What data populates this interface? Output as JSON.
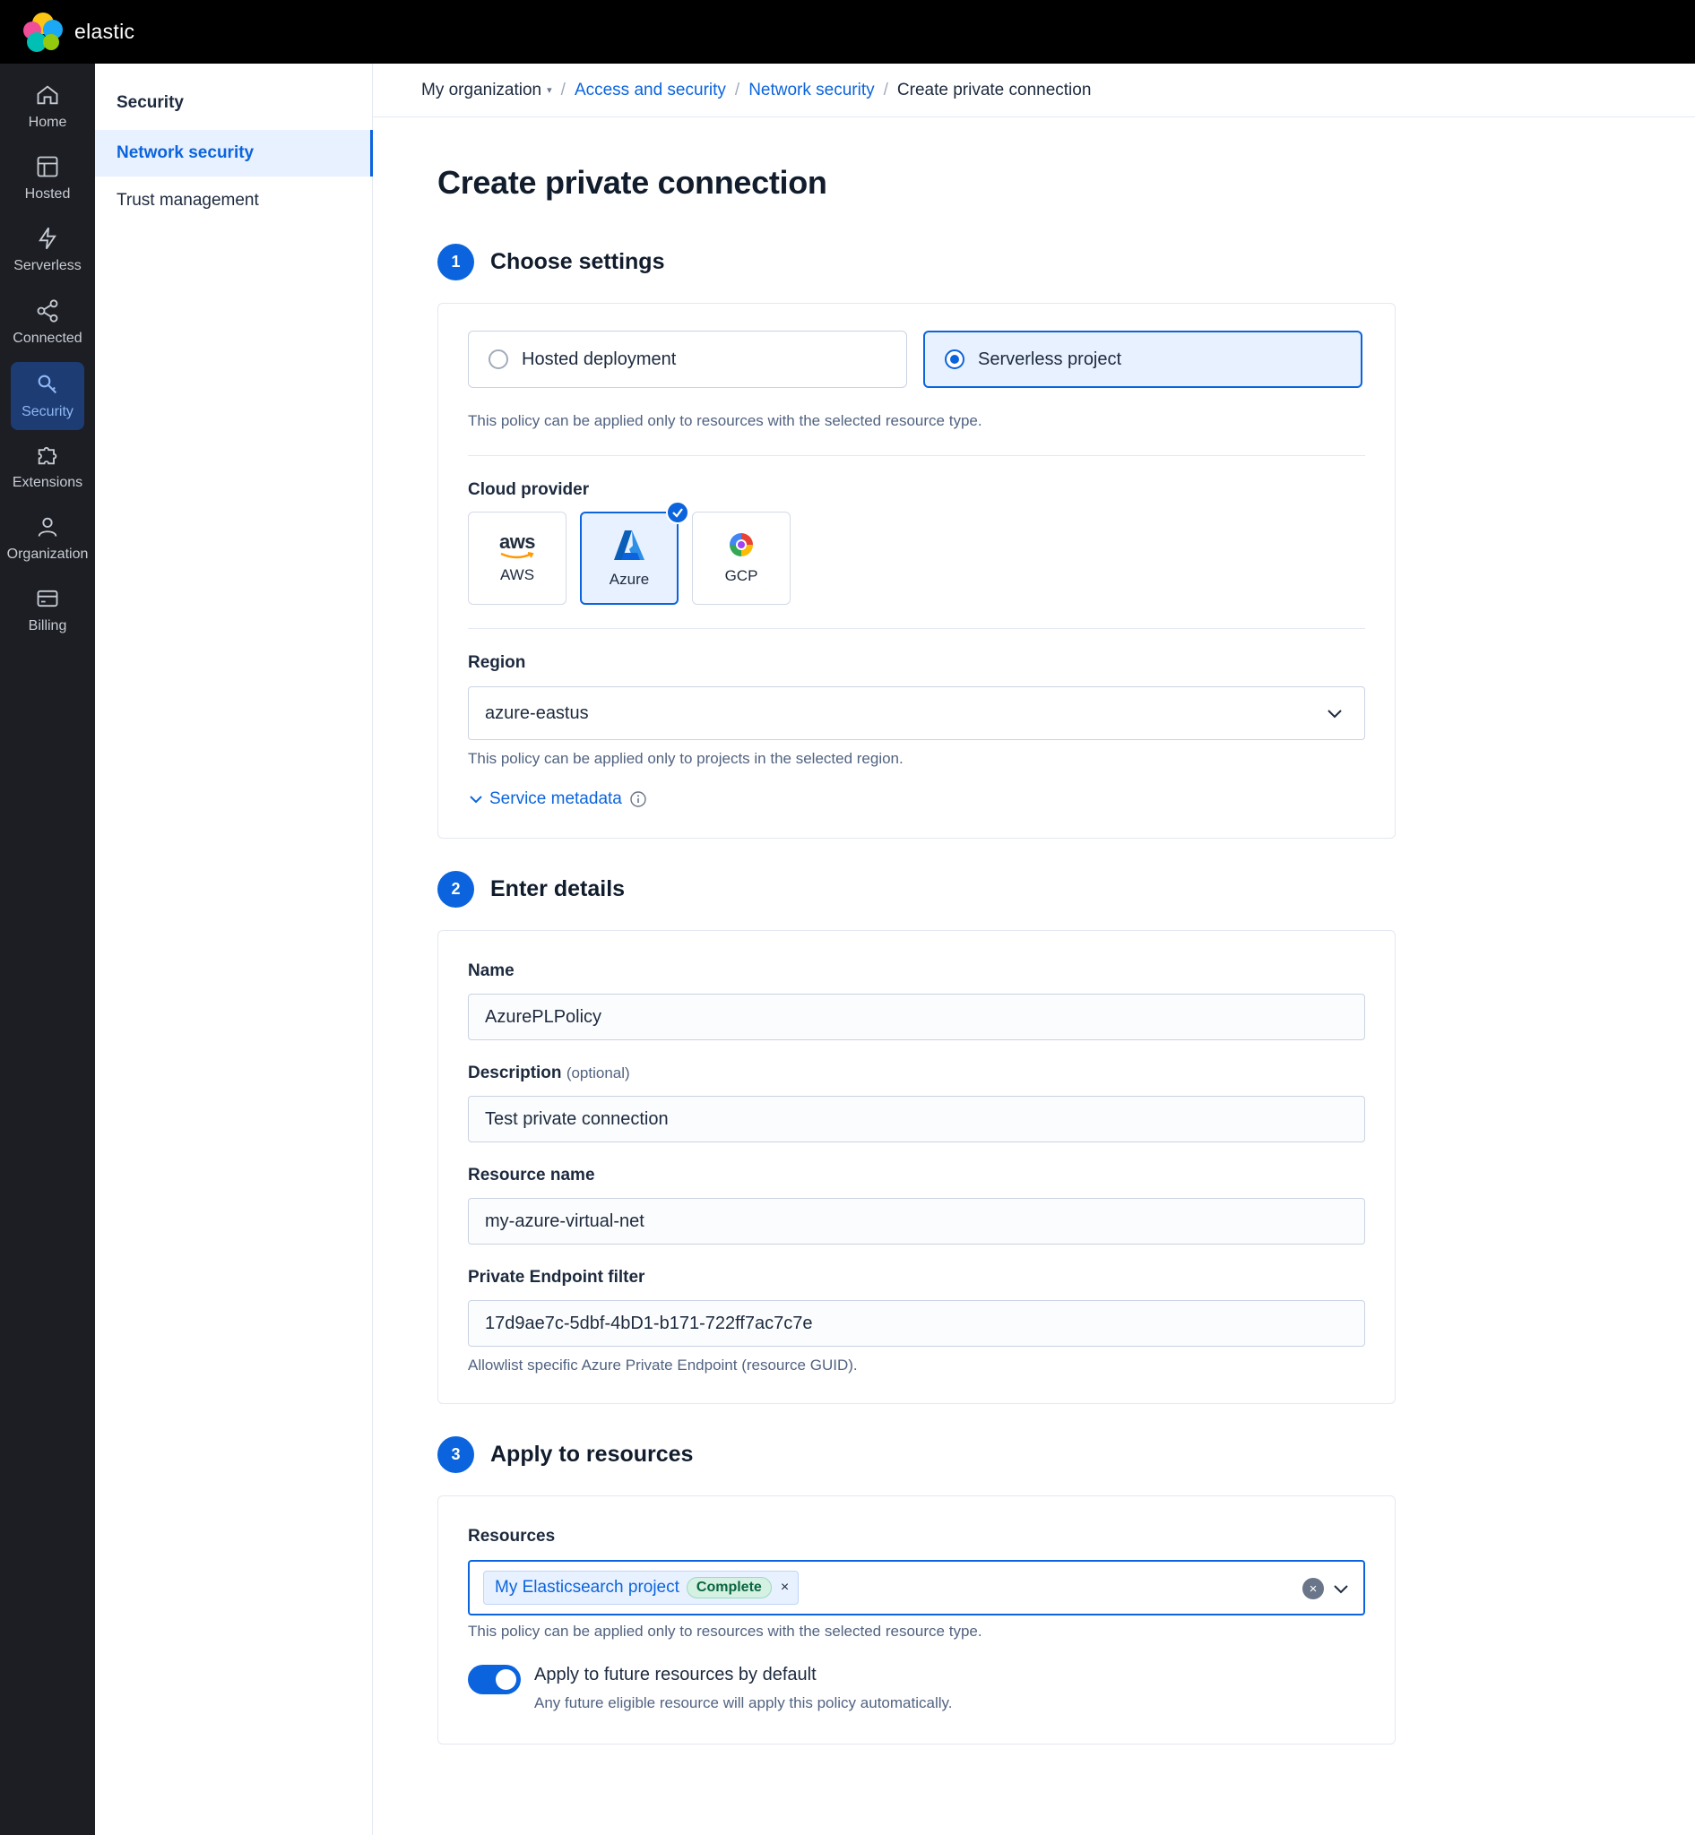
{
  "app": {
    "brand": "elastic"
  },
  "rail": {
    "items": [
      {
        "label": "Home",
        "icon": "home-icon"
      },
      {
        "label": "Hosted",
        "icon": "hosted-icon"
      },
      {
        "label": "Serverless",
        "icon": "bolt-icon"
      },
      {
        "label": "Connected",
        "icon": "share-icon"
      },
      {
        "label": "Security",
        "icon": "key-icon",
        "active": true
      },
      {
        "label": "Extensions",
        "icon": "puzzle-icon"
      },
      {
        "label": "Organization",
        "icon": "user-icon"
      },
      {
        "label": "Billing",
        "icon": "card-icon"
      }
    ]
  },
  "subnav": {
    "title": "Security",
    "items": [
      {
        "label": "Network security",
        "active": true
      },
      {
        "label": "Trust management"
      }
    ]
  },
  "breadcrumb": {
    "org": "My organization",
    "access": "Access and security",
    "network": "Network security",
    "current": "Create private connection"
  },
  "page": {
    "title": "Create private connection"
  },
  "step1": {
    "num": "1",
    "title": "Choose settings",
    "resource_types": [
      {
        "label": "Hosted deployment",
        "selected": false
      },
      {
        "label": "Serverless project",
        "selected": true
      }
    ],
    "resource_help": "This policy can be applied only to resources with the selected resource type.",
    "cloud_label": "Cloud provider",
    "providers": [
      {
        "label": "AWS",
        "logo_text": "aws"
      },
      {
        "label": "Azure",
        "selected": true
      },
      {
        "label": "GCP"
      }
    ],
    "region_label": "Region",
    "region_value": "azure-eastus",
    "region_help": "This policy can be applied only to projects in the selected region.",
    "metadata_link": "Service metadata"
  },
  "step2": {
    "num": "2",
    "title": "Enter details",
    "name_label": "Name",
    "name_value": "AzurePLPolicy",
    "desc_label": "Description",
    "desc_optional": "(optional)",
    "desc_value": "Test private connection",
    "resource_label": "Resource name",
    "resource_value": "my-azure-virtual-net",
    "filter_label": "Private Endpoint filter",
    "filter_value": "17d9ae7c-5dbf-4bD1-b171-722ff7ac7c7e",
    "filter_help": "Allowlist specific Azure Private Endpoint (resource GUID)."
  },
  "step3": {
    "num": "3",
    "title": "Apply to resources",
    "resources_label": "Resources",
    "pill_label": "My Elasticsearch project",
    "pill_badge": "Complete",
    "resources_help": "This policy can be applied only to resources with the selected resource type.",
    "toggle_label": "Apply to future resources by default",
    "toggle_help": "Any future eligible resource will apply this policy automatically.",
    "toggle_on": true
  },
  "colors": {
    "accent": "#0b64dd",
    "rail_bg": "#1d1e24",
    "success_badge": "#d4f1e3"
  }
}
